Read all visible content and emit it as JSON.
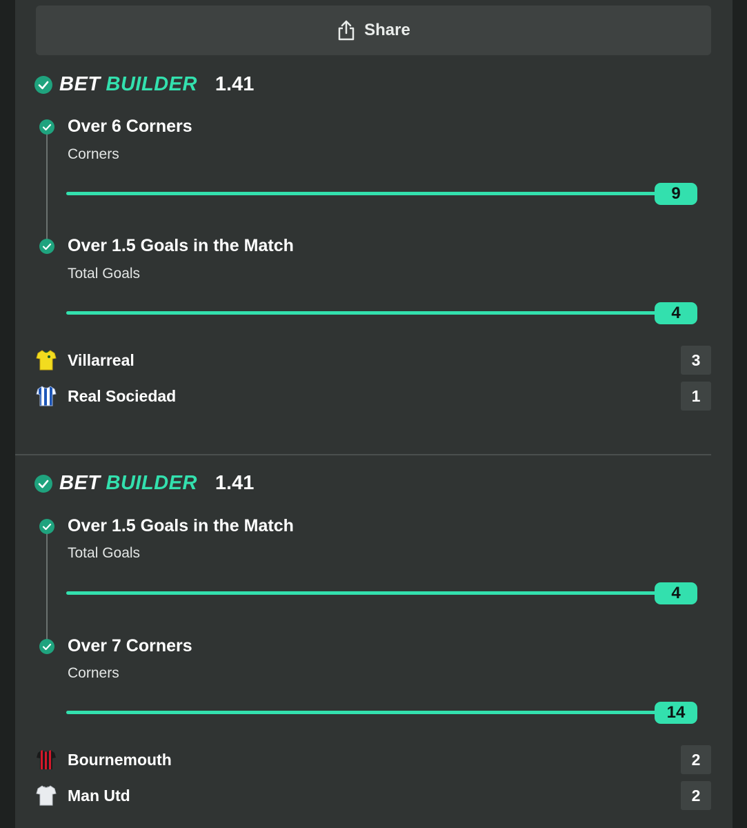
{
  "share": {
    "label": "Share"
  },
  "colors": {
    "accent": "#33e0ae",
    "panel": "#303433",
    "scorebox": "#3f4443"
  },
  "bet_builders": [
    {
      "title_part1": "BET",
      "title_part2": "BUILDER",
      "odds": "1.41",
      "legs": [
        {
          "title": "Over 6 Corners",
          "subtitle": "Corners",
          "result": "9",
          "progress_pct": 100
        },
        {
          "title": "Over 1.5 Goals in the Match",
          "subtitle": "Total Goals",
          "result": "4",
          "progress_pct": 100
        }
      ],
      "teams": [
        {
          "name": "Villarreal",
          "score": "3",
          "shirt": "villarreal-shirt-icon"
        },
        {
          "name": "Real Sociedad",
          "score": "1",
          "shirt": "real-sociedad-shirt-icon"
        }
      ]
    },
    {
      "title_part1": "BET",
      "title_part2": "BUILDER",
      "odds": "1.41",
      "legs": [
        {
          "title": "Over 1.5 Goals in the Match",
          "subtitle": "Total Goals",
          "result": "4",
          "progress_pct": 100
        },
        {
          "title": "Over 7 Corners",
          "subtitle": "Corners",
          "result": "14",
          "progress_pct": 100
        }
      ],
      "teams": [
        {
          "name": "Bournemouth",
          "score": "2",
          "shirt": "bournemouth-shirt-icon"
        },
        {
          "name": "Man Utd",
          "score": "2",
          "shirt": "man-utd-shirt-icon"
        }
      ]
    }
  ]
}
